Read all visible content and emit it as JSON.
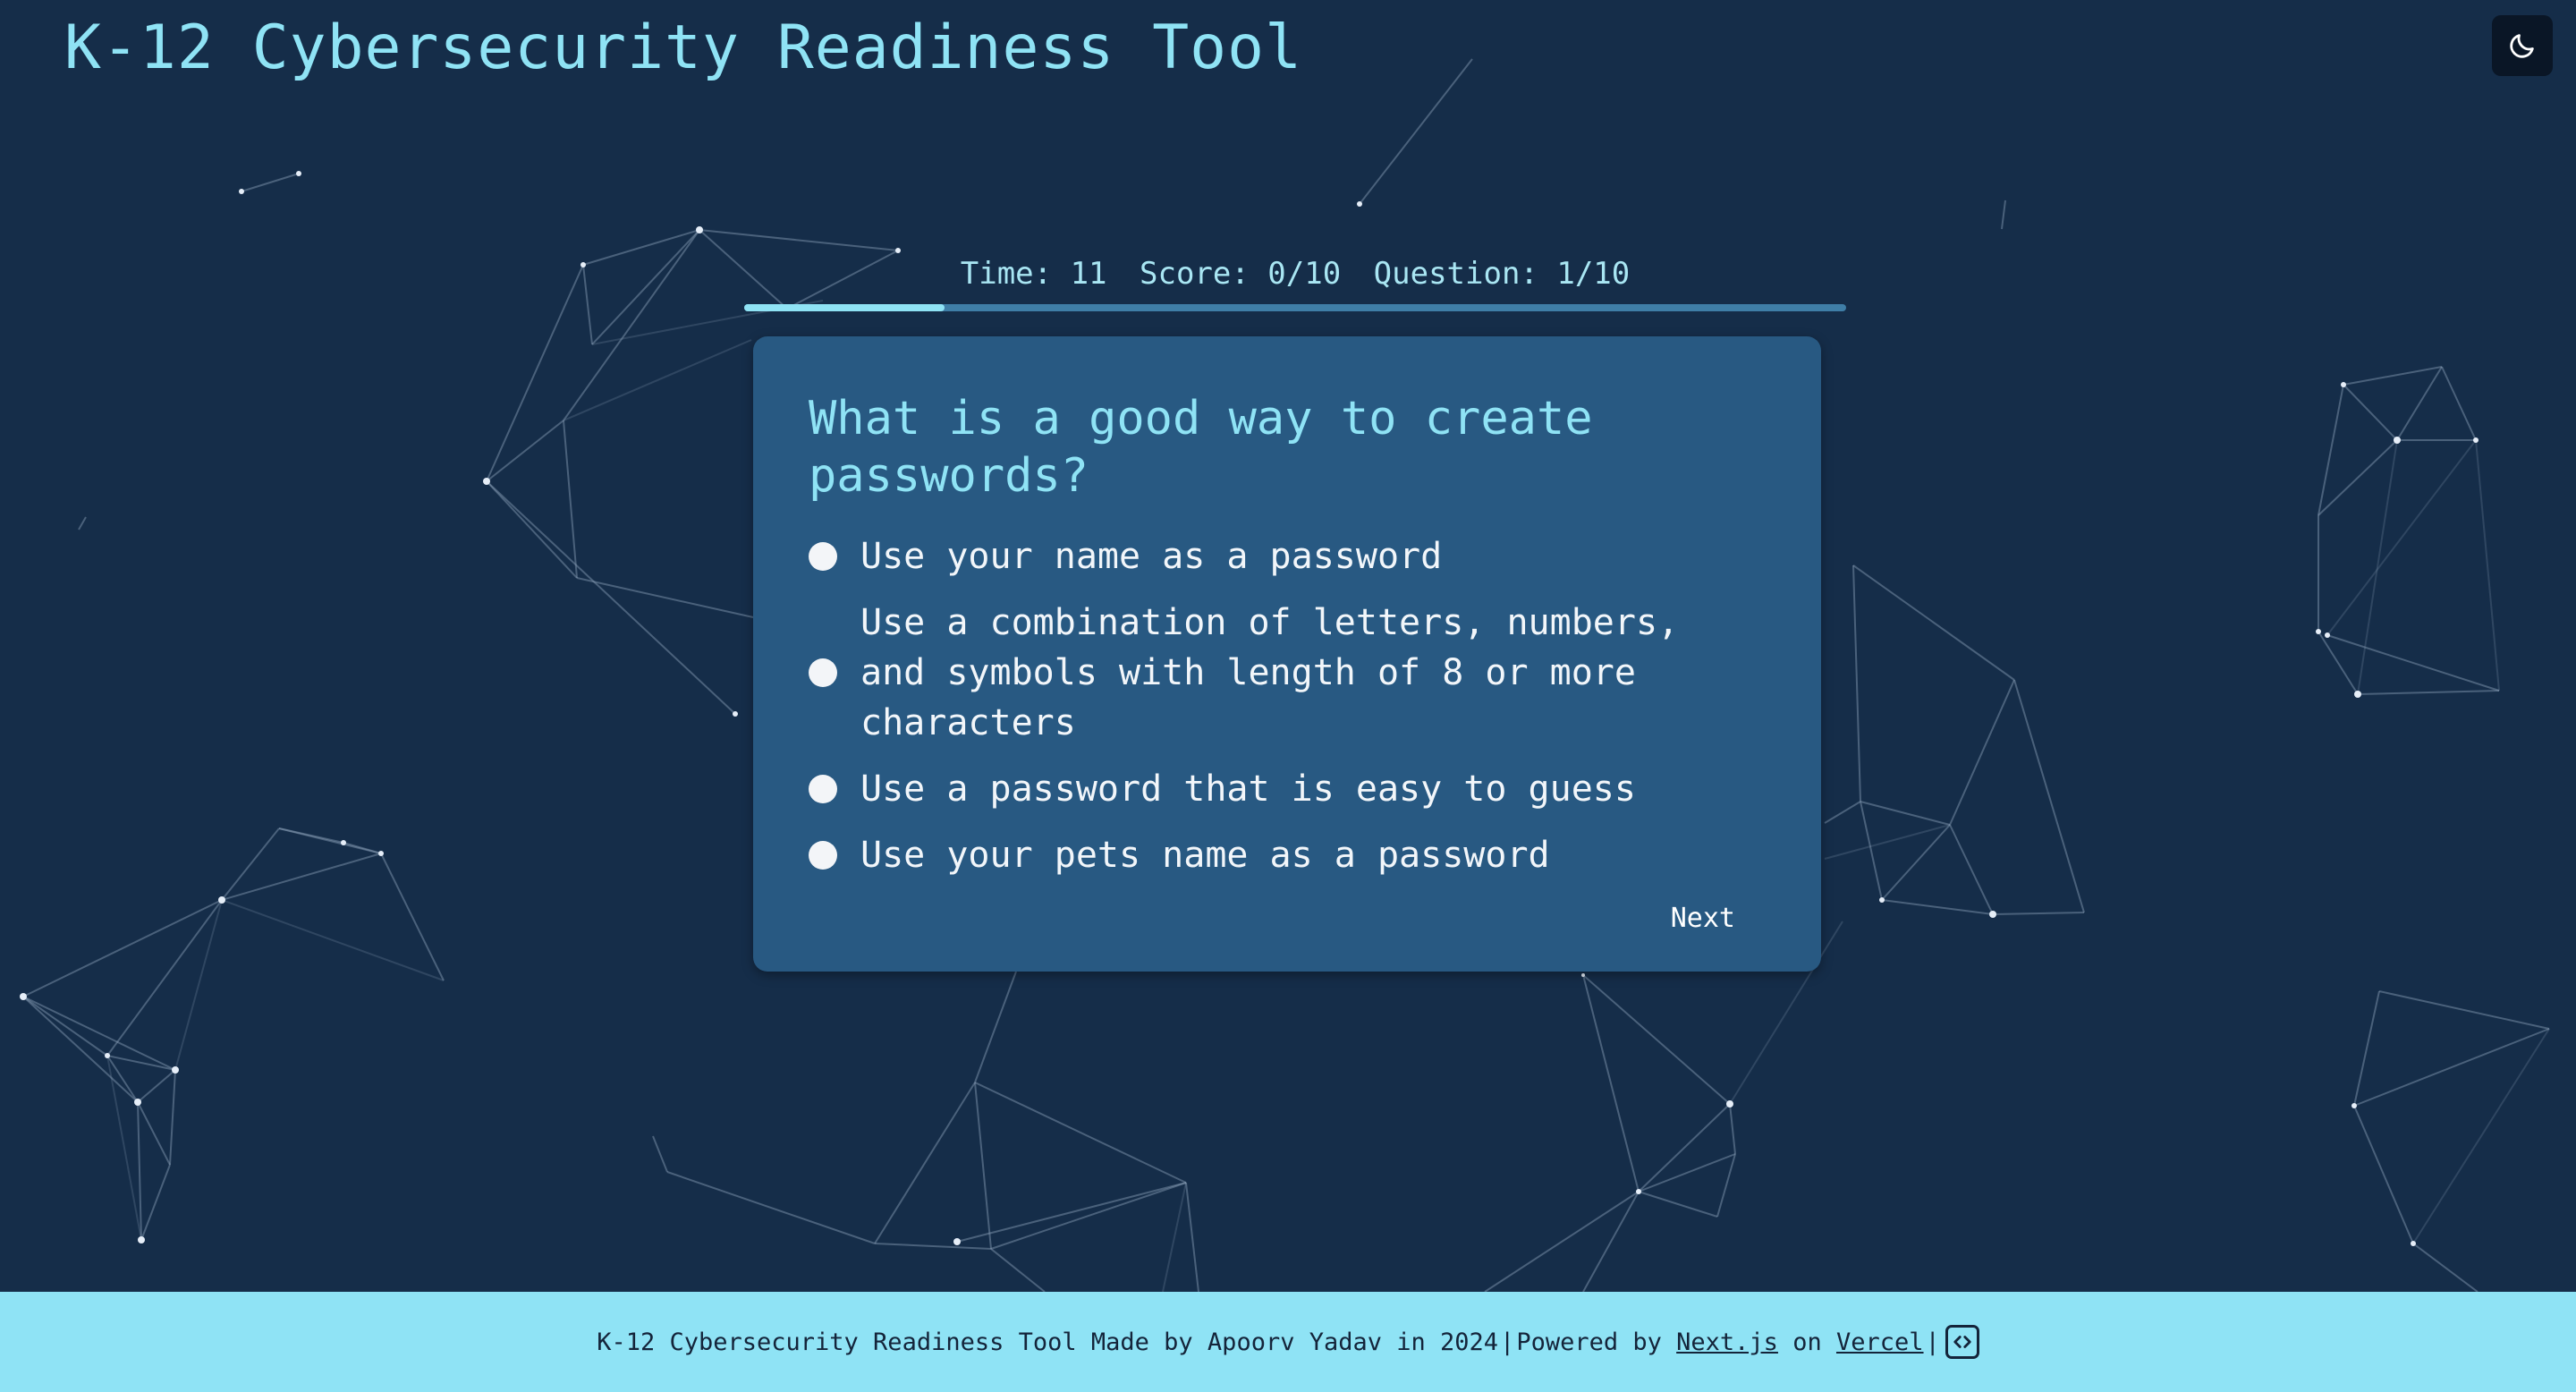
{
  "app": {
    "title": "K-12 Cybersecurity Readiness Tool",
    "theme_toggle_icon": "moon-icon"
  },
  "status": {
    "time": "Time: 11",
    "score": "Score: 0/10",
    "question": "Question: 1/10",
    "progress_fraction": 0.1818
  },
  "quiz": {
    "question": "What is a good way to create passwords?",
    "options": [
      "Use your name as a password",
      "Use a combination of letters, numbers, and symbols with length of 8 or more characters",
      "Use a password that is easy to guess",
      "Use your pets name as a password"
    ],
    "next_label": "Next"
  },
  "footer": {
    "text": "K-12 Cybersecurity Readiness Tool Made by Apoorv Yadav in 2024",
    "separator": "|",
    "powered_by": "Powered by",
    "nextjs_link": "Next.js",
    "on": "on",
    "vercel_link": "Vercel",
    "source_icon": "code-icon"
  },
  "colors": {
    "background": "#152d49",
    "accent": "#8fe3f5",
    "card": "#285982",
    "footer_bg": "#8fe3f5"
  }
}
